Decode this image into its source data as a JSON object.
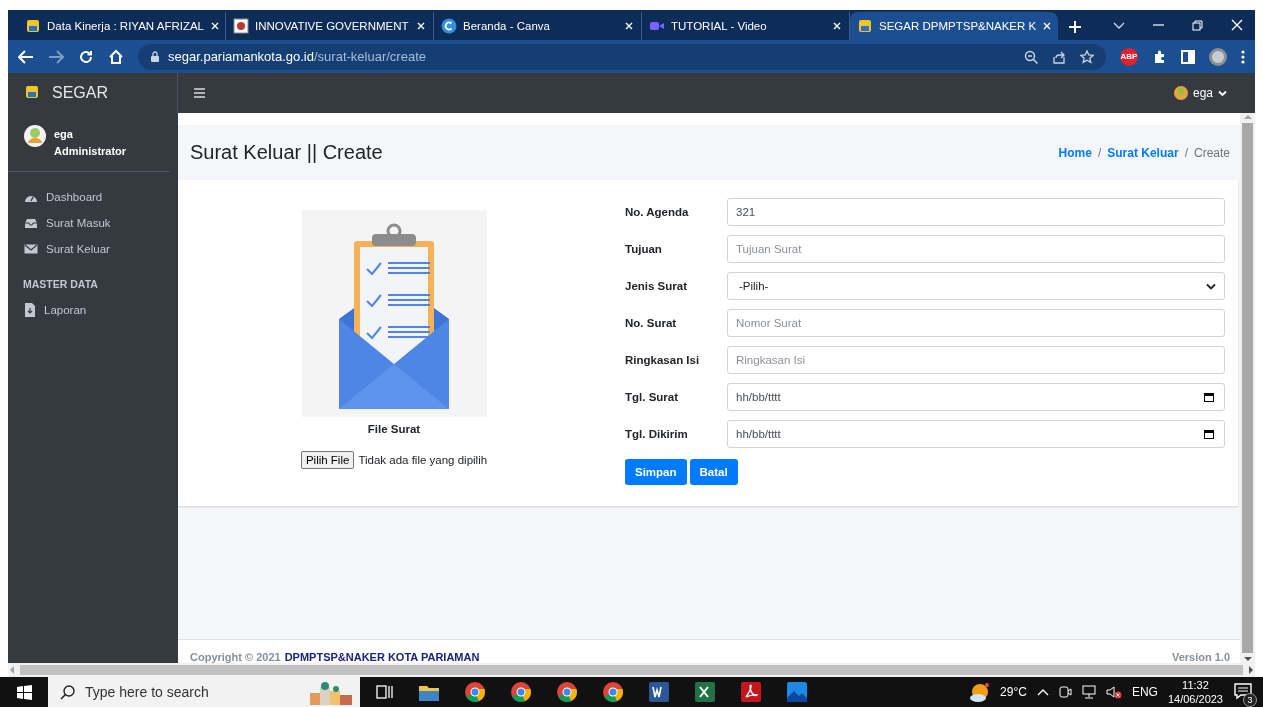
{
  "browser": {
    "tabs": [
      {
        "title": "Data Kinerja : RIYAN AFRIZAL",
        "selected": false
      },
      {
        "title": "INNOVATIVE GOVERNMENT",
        "selected": false
      },
      {
        "title": "Beranda - Canva",
        "selected": false
      },
      {
        "title": "TUTORIAL - Video",
        "selected": false
      },
      {
        "title": "SEGAR DPMPTSP&NAKER K",
        "selected": true
      }
    ],
    "address": {
      "domain": "segar.pariamankota.go.id",
      "path": "/surat-keluar/create"
    },
    "extension_badge": "ABP"
  },
  "app": {
    "brand": "SEGAR",
    "user_menu": "ega",
    "sidebar": {
      "user": {
        "name": "ega",
        "role": "Administrator"
      },
      "items": [
        {
          "label": "Dashboard"
        },
        {
          "label": "Surat Masuk"
        },
        {
          "label": "Surat Keluar"
        }
      ],
      "section": "MASTER DATA",
      "section_items": [
        {
          "label": "Laporan"
        }
      ]
    },
    "page": {
      "title": "Surat Keluar || Create",
      "breadcrumb": [
        {
          "kind": "link",
          "label": "Home"
        },
        {
          "kind": "separator",
          "label": "/"
        },
        {
          "kind": "link",
          "label": "Surat Keluar"
        },
        {
          "kind": "separator",
          "label": "/"
        },
        {
          "kind": "current",
          "label": "Create"
        }
      ]
    },
    "form": {
      "file_caption": "File Surat",
      "file_button": "Pilih File",
      "file_status": "Tidak ada file yang dipilih",
      "fields": [
        {
          "label": "No. Agenda",
          "kind": "text",
          "value": "321"
        },
        {
          "label": "Tujuan",
          "kind": "text",
          "placeholder": "Tujuan Surat"
        },
        {
          "label": "Jenis Surat",
          "kind": "select",
          "value": "-Pilih-"
        },
        {
          "label": "No. Surat",
          "kind": "text",
          "placeholder": "Nomor Surat"
        },
        {
          "label": "Ringkasan Isi",
          "kind": "text",
          "placeholder": "Ringkasan Isi"
        },
        {
          "label": "Tgl. Surat",
          "kind": "date",
          "value": "hh/bb/tttt"
        },
        {
          "label": "Tgl. Dikirim",
          "kind": "date",
          "value": "hh/bb/tttt"
        }
      ],
      "buttons": [
        "Simpan",
        "Batal"
      ]
    },
    "footer": {
      "copyright": "Copyright © 2021",
      "organization": "DPMPTSP&NAKER KOTA PARIAMAN",
      "version": "Version 1.0"
    }
  },
  "taskbar": {
    "search_placeholder": "Type here to search",
    "temperature": "29°C",
    "language": "ENG",
    "time": "11:32",
    "date": "14/06/2023",
    "notification_count": "3"
  }
}
